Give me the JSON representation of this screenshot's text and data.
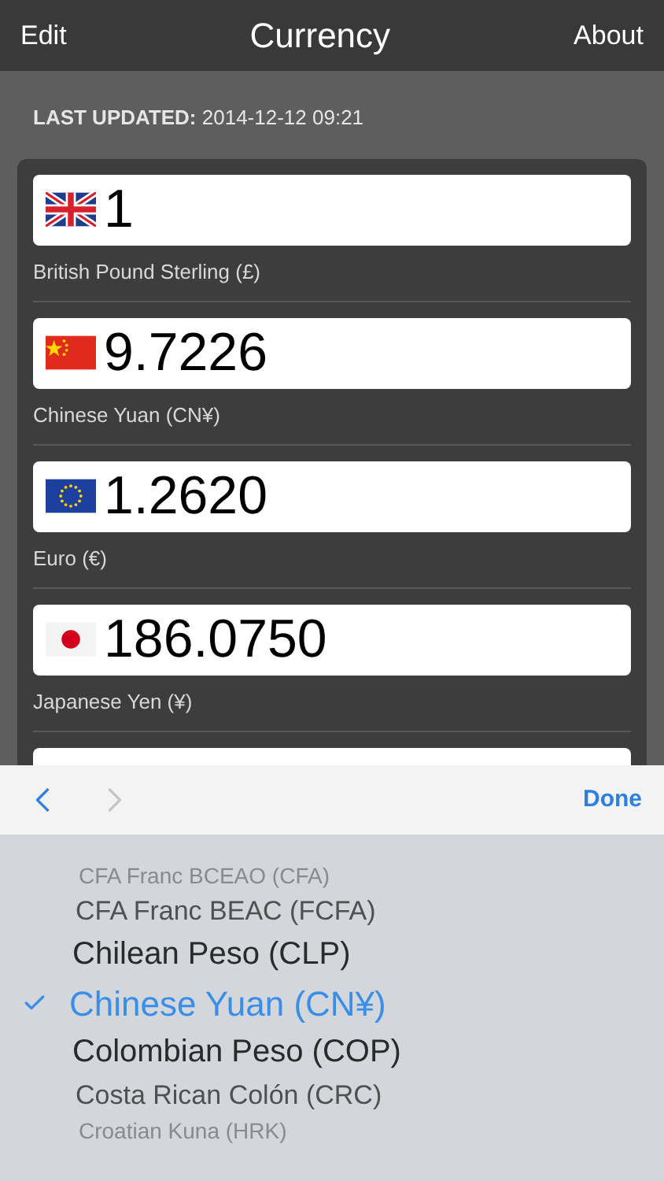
{
  "nav": {
    "left": "Edit",
    "title": "Currency",
    "right": "About"
  },
  "last_updated": {
    "label": "LAST UPDATED:",
    "value": "2014-12-12 09:21"
  },
  "rows": [
    {
      "kind": "gb",
      "value": "1",
      "name": "British Pound Sterling (£)"
    },
    {
      "kind": "cn",
      "value": "9.7226",
      "name": "Chinese Yuan (CN¥)"
    },
    {
      "kind": "eu",
      "value": "1.2620",
      "name": "Euro (€)"
    },
    {
      "kind": "jp",
      "value": "186.0750",
      "name": "Japanese Yen (¥)"
    }
  ],
  "toolbar": {
    "prev_enabled": true,
    "next_enabled": false,
    "done": "Done"
  },
  "picker": [
    {
      "label": "CFA Franc BCEAO (CFA)",
      "selected": false
    },
    {
      "label": "CFA Franc BEAC (FCFA)",
      "selected": false
    },
    {
      "label": "Chilean Peso (CLP)",
      "selected": false
    },
    {
      "label": "Chinese Yuan (CN¥)",
      "selected": true
    },
    {
      "label": "Colombian Peso (COP)",
      "selected": false
    },
    {
      "label": "Costa Rican Colón (CRC)",
      "selected": false
    },
    {
      "label": "Croatian Kuna (HRK)",
      "selected": false
    }
  ]
}
